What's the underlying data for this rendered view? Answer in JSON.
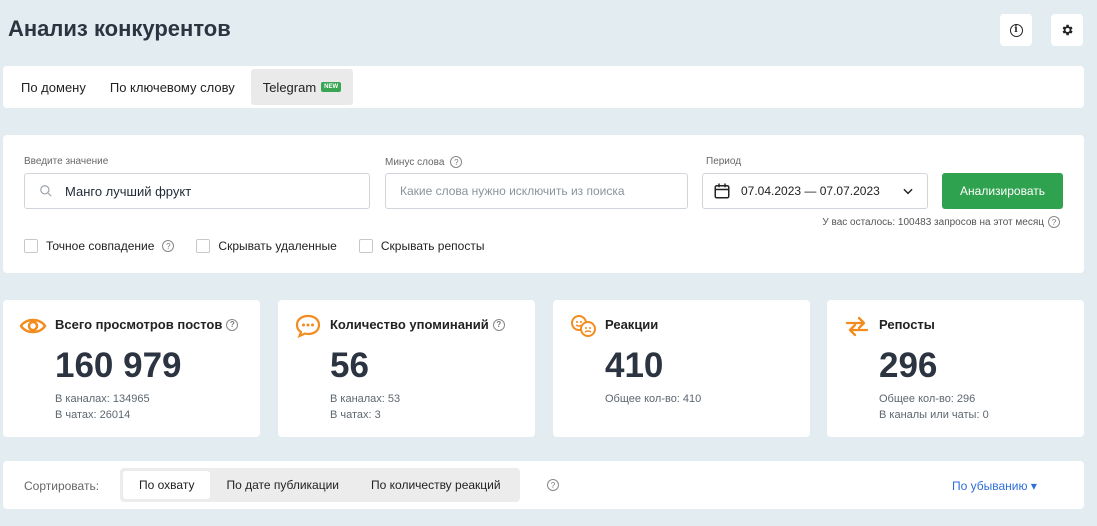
{
  "header": {
    "title": "Анализ конкурентов",
    "info_icon": "info-icon",
    "settings_icon": "gear-icon"
  },
  "tabs": [
    {
      "label": "По домену"
    },
    {
      "label": "По ключевому слову"
    },
    {
      "label": "Telegram",
      "badge": "NEW",
      "active": true
    }
  ],
  "search": {
    "query_label": "Введите значение",
    "query_value": "Манго лучший фрукт",
    "minus_label": "Минус слова",
    "minus_placeholder": "Какие слова нужно исключить из поиска",
    "period_label": "Период",
    "period_value": "07.04.2023 — 07.07.2023",
    "analyze_label": "Анализировать",
    "quota_text": "У вас осталось: 100483 запросов на этот месяц",
    "checkboxes": [
      "Точное совпадение",
      "Скрывать удаленные",
      "Скрывать репосты"
    ]
  },
  "cards": [
    {
      "title": "Всего просмотров постов",
      "value": "160 979",
      "sub1": "В каналах: 134965",
      "sub2": "В чатах: 26014",
      "icon": "eye-icon"
    },
    {
      "title": "Количество упоминаний",
      "value": "56",
      "sub1": "В каналах: 53",
      "sub2": "В чатах: 3",
      "icon": "chat-bubble-icon"
    },
    {
      "title": "Реакции",
      "value": "410",
      "sub1": "Общее кол-во: 410",
      "sub2": "",
      "icon": "emoji-icon"
    },
    {
      "title": "Репосты",
      "value": "296",
      "sub1": "Общее кол-во: 296",
      "sub2": "В каналы или чаты: 0",
      "icon": "repost-icon"
    }
  ],
  "sort": {
    "label": "Сортировать:",
    "options": [
      "По охвату",
      "По дате публикации",
      "По количеству реакций"
    ],
    "active_index": 0,
    "order_label": "По убыванию"
  },
  "colors": {
    "accent_orange": "#f28c1e",
    "button_green": "#2fa24f",
    "link_blue": "#2f6fd6",
    "badge_green": "#3aa655"
  }
}
